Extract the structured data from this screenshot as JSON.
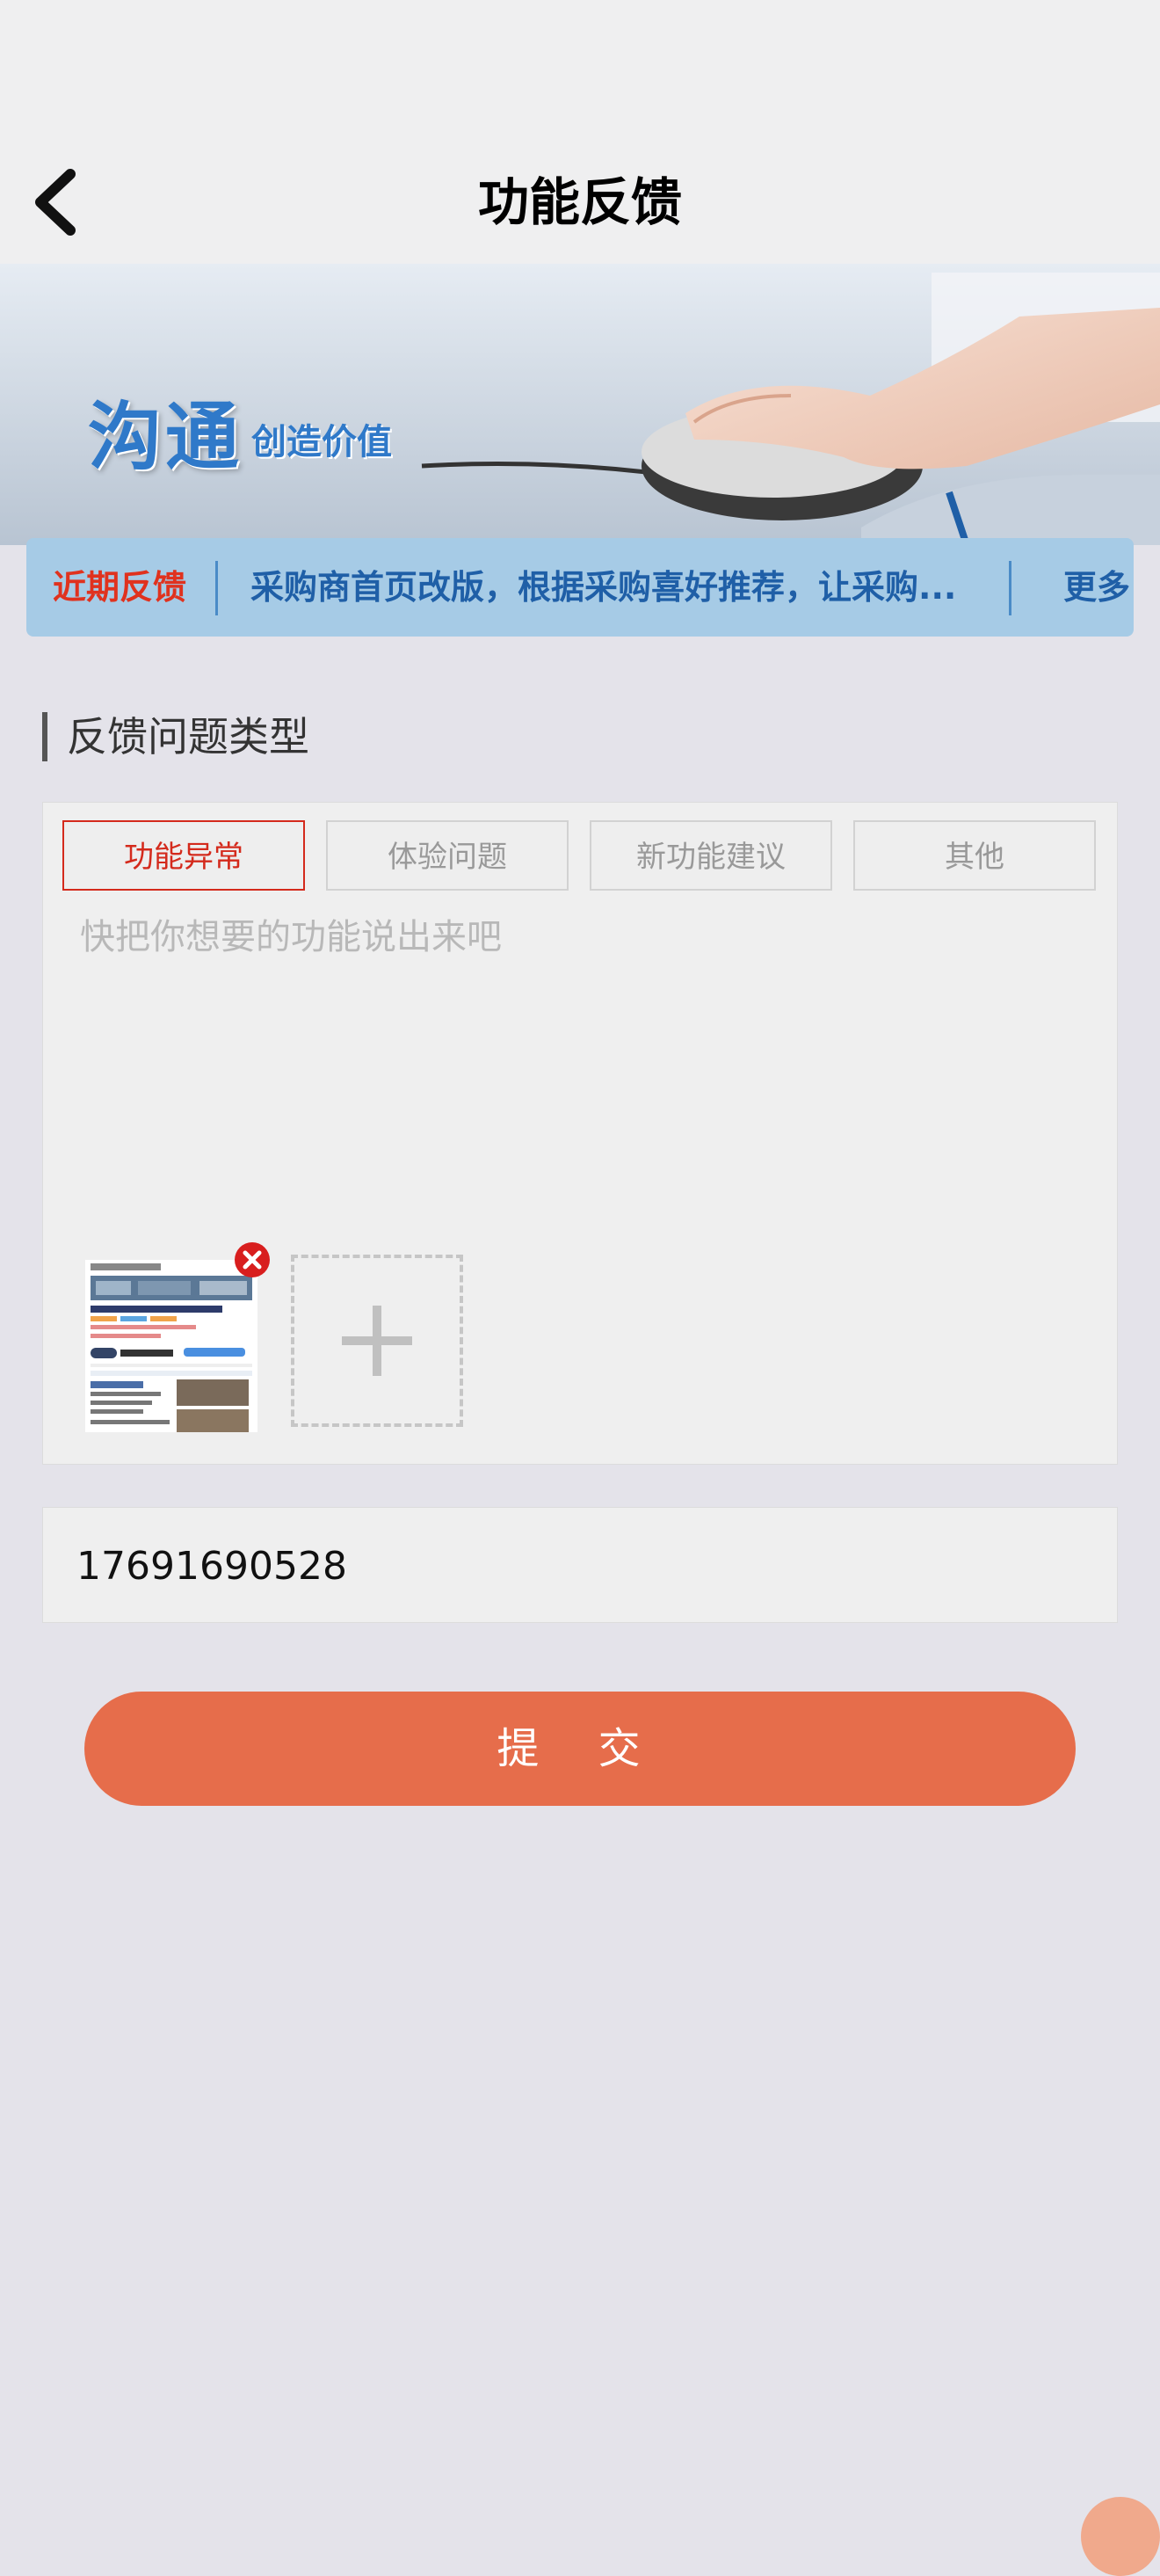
{
  "header": {
    "title": "功能反馈",
    "back_icon": "chevron-left-icon"
  },
  "banner": {
    "main_text": "沟通",
    "sub_text": "创造价值"
  },
  "notice": {
    "tag": "近期反馈",
    "text": "采购商首页改版，根据采购喜好推荐，让采购...",
    "more": "更多"
  },
  "feedback": {
    "section_title": "反馈问题类型",
    "types": [
      {
        "label": "功能异常",
        "selected": true
      },
      {
        "label": "体验问题",
        "selected": false
      },
      {
        "label": "新功能建议",
        "selected": false
      },
      {
        "label": "其他",
        "selected": false
      }
    ],
    "placeholder": "快把你想要的功能说出来吧",
    "value": "",
    "attachments_count": 1,
    "add_icon": "plus-icon",
    "remove_icon": "close-icon"
  },
  "contact": {
    "value": "17691690528"
  },
  "submit": {
    "label": "提 交"
  },
  "colors": {
    "accent": "#e66d4b",
    "selected_tab": "#d42a1c",
    "notice_bg": "#a6cbe6",
    "link": "#1f5fa7"
  }
}
